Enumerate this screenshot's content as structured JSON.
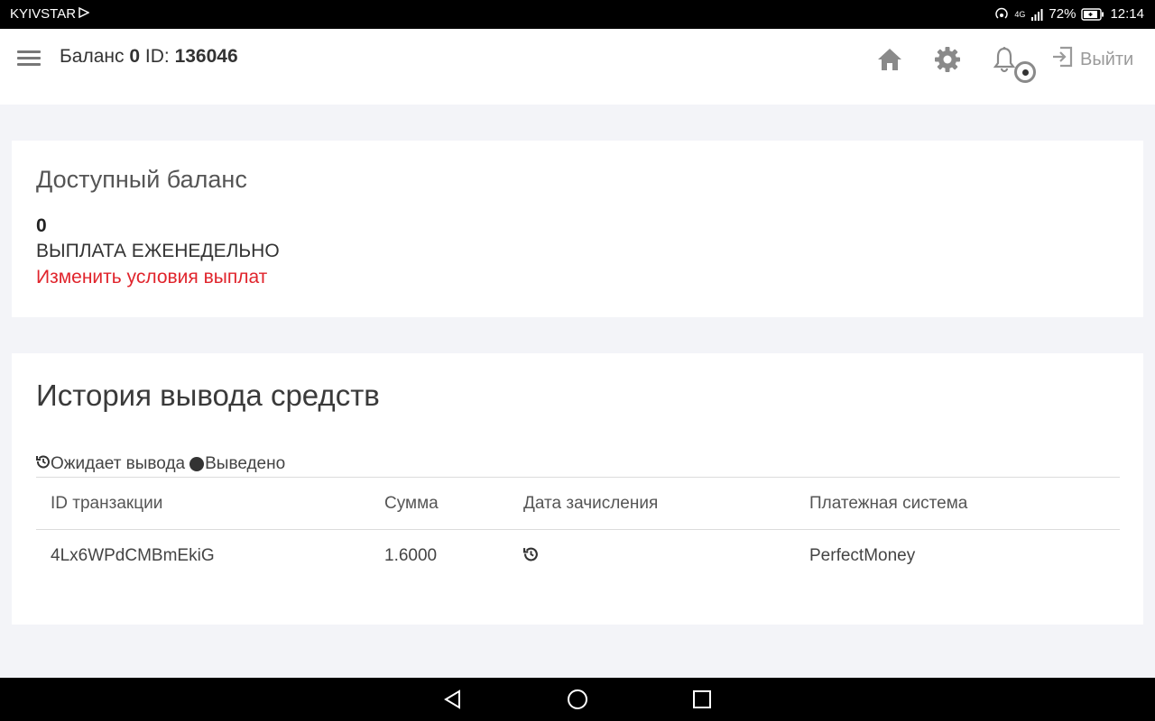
{
  "status_bar": {
    "carrier": "KYIVSTAR",
    "network": "4G",
    "battery": "72%",
    "time": "12:14"
  },
  "header": {
    "balance_label": "Баланс",
    "balance_value": "0",
    "id_label": "ID:",
    "id_value": "136046",
    "logout_label": "Выйти",
    "icons": [
      "menu-icon",
      "home-icon",
      "gear-icon",
      "bell-icon",
      "logout-icon"
    ]
  },
  "balance_card": {
    "title": "Доступный баланс",
    "amount": "0",
    "payout_frequency": "ВЫПЛАТА ЕЖЕНЕДЕЛЬНО",
    "change_link": "Изменить условия выплат",
    "link_color": "#e0242c"
  },
  "history": {
    "title": "История вывода средств",
    "legend_pending": "Ожидает вывода",
    "legend_done": "Выведено",
    "columns": [
      "ID транзакции",
      "Сумма",
      "Дата зачисления",
      "Платежная система"
    ],
    "rows": [
      {
        "id": "4Lx6WPdCMBmEkiG",
        "amount": "1.6000",
        "date_icon": "history-icon",
        "system": "PerfectMoney"
      }
    ]
  }
}
